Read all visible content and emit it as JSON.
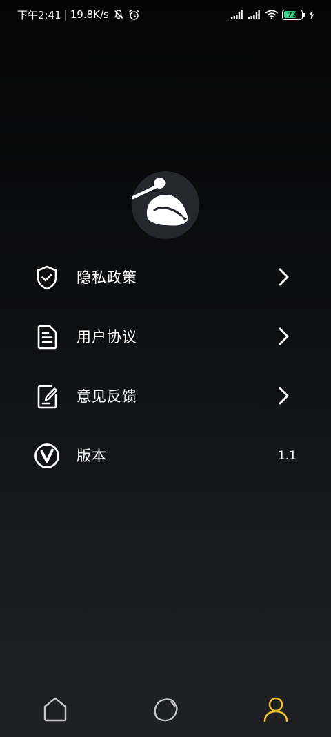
{
  "status_bar": {
    "time": "下午2:41",
    "network_speed": "19.8K/s",
    "battery_percent": "73",
    "battery_level": 0.73,
    "icons": [
      "mute-icon",
      "alarm-icon",
      "signal-icon",
      "signal-icon",
      "wifi-icon",
      "battery-icon",
      "charging-icon"
    ]
  },
  "logo": {
    "icon": "drum-logo-icon"
  },
  "menu": {
    "items": [
      {
        "label": "隐私政策",
        "icon": "shield-check-icon",
        "has_chevron": true
      },
      {
        "label": "用户协议",
        "icon": "document-icon",
        "has_chevron": true
      },
      {
        "label": "意见反馈",
        "icon": "edit-note-icon",
        "has_chevron": true
      },
      {
        "label": "版本",
        "icon": "version-icon",
        "value": "1.1",
        "has_chevron": false
      }
    ]
  },
  "bottom_nav": {
    "items": [
      {
        "icon": "home-icon",
        "active": false
      },
      {
        "icon": "fruit-icon",
        "active": false
      },
      {
        "icon": "profile-icon",
        "active": true
      }
    ]
  },
  "colors": {
    "accent": "#f0c020",
    "inactive": "#c8c8c8",
    "text": "#ffffff"
  }
}
